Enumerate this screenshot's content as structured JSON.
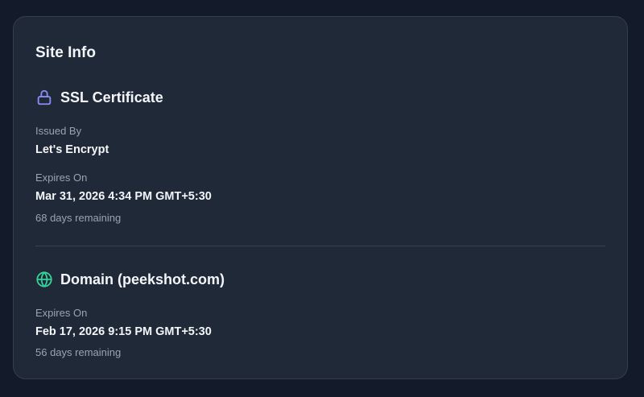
{
  "card": {
    "title": "Site Info"
  },
  "ssl": {
    "heading": "SSL Certificate",
    "icon": "lock-icon",
    "icon_color": "#8b8cf6",
    "issued_by_label": "Issued By",
    "issued_by_value": "Let's Encrypt",
    "expires_label": "Expires On",
    "expires_value": "Mar 31, 2026 4:34 PM GMT+5:30",
    "remaining": "68 days remaining"
  },
  "domain": {
    "heading": "Domain (peekshot.com)",
    "icon": "globe-icon",
    "icon_color": "#34d399",
    "expires_label": "Expires On",
    "expires_value": "Feb 17, 2026 9:15 PM GMT+5:30",
    "remaining": "56 days remaining"
  }
}
